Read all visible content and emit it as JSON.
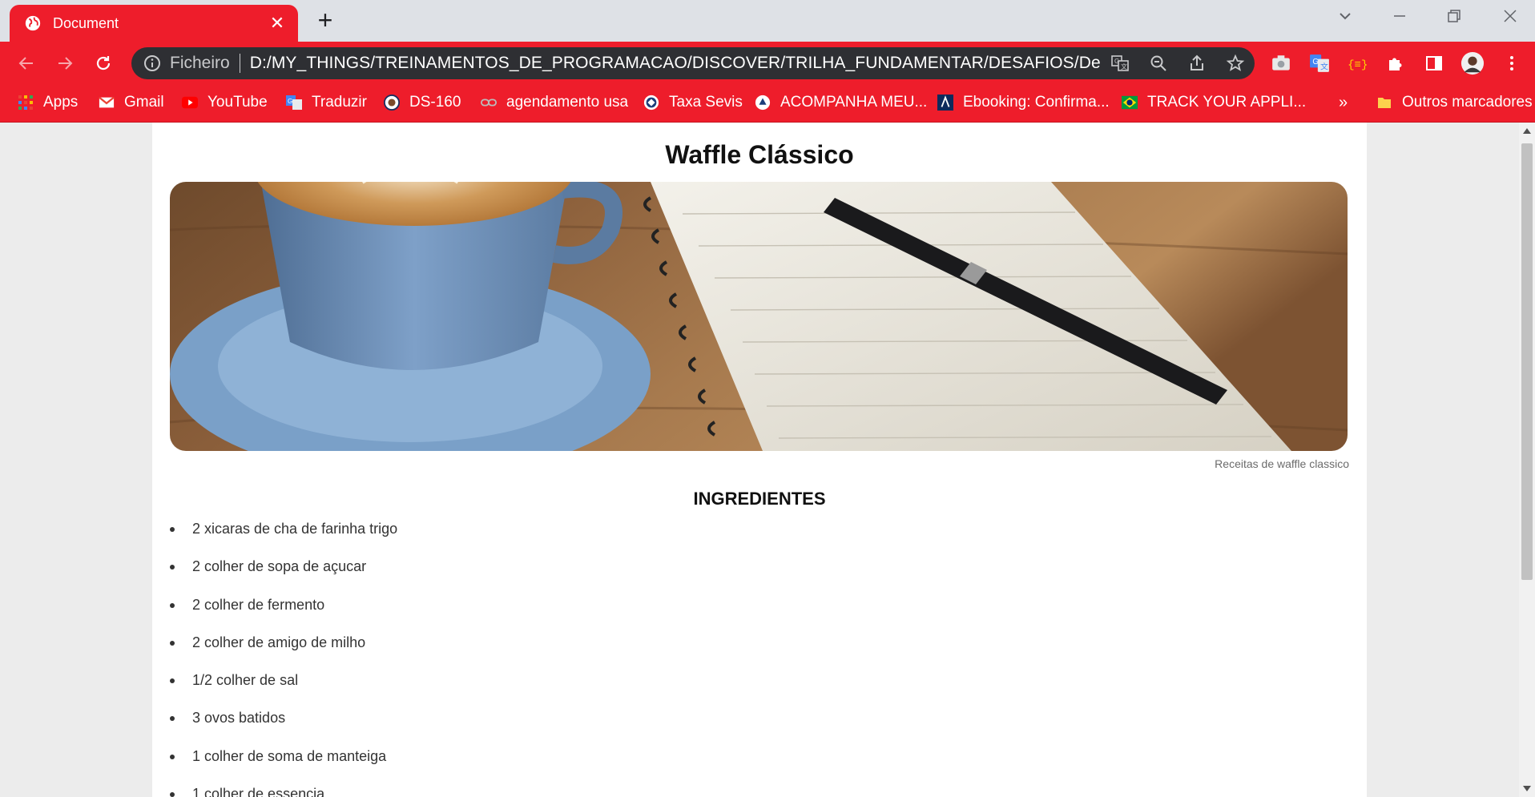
{
  "browser": {
    "tab_title": "Document",
    "tab_close_glyph": "✕",
    "new_tab_glyph": "+",
    "address_scheme": "Ficheiro",
    "address_url": "D:/MY_THINGS/TREINAMENTOS_DE_PROGRAMACAO/DISCOVER/TRILHA_FUNDAMENTAR/DESAFIOS/Desafio%...",
    "colors": {
      "chrome_accent": "#ee1d2b",
      "omnibox_bg": "#2e2f33",
      "tabstrip_bg": "#dee1e6"
    },
    "icons": [
      "back-icon",
      "forward-icon",
      "reload-icon",
      "info-icon",
      "translate-icon",
      "zoom-out-icon",
      "share-icon",
      "star-icon",
      "camera-icon",
      "google-translate-icon",
      "code-icon",
      "puzzle-icon",
      "side-panel-icon",
      "profile-avatar",
      "menu-icon"
    ]
  },
  "bookmarks": {
    "items": [
      {
        "label": "Apps",
        "icon": "apps-grid-icon"
      },
      {
        "label": "Gmail",
        "icon": "gmail-icon"
      },
      {
        "label": "YouTube",
        "icon": "youtube-icon"
      },
      {
        "label": "Traduzir",
        "icon": "translate-icon"
      },
      {
        "label": "DS-160",
        "icon": "seal-icon"
      },
      {
        "label": "agendamento usa",
        "icon": "link-icon"
      },
      {
        "label": "Taxa Sevis",
        "icon": "sevis-icon"
      },
      {
        "label": "ACOMPANHA MEU...",
        "icon": "uscis-icon"
      },
      {
        "label": "Ebooking: Confirma...",
        "icon": "ebooking-icon"
      },
      {
        "label": "TRACK YOUR APPLI...",
        "icon": "brazil-flag-icon"
      }
    ],
    "more_glyph": "»",
    "other_label": "Outros marcadores"
  },
  "page": {
    "title": "Waffle Clássico",
    "image_caption": "Receitas de waffle classico",
    "section_title": "INGREDIENTES",
    "ingredients": [
      "2 xicaras de cha de farinha trigo",
      "2 colher de sopa de açucar",
      "2 colher de fermento",
      "2 colher de amigo de milho",
      "1/2 colher de sal",
      "3 ovos batidos",
      "1 colher de soma de manteiga",
      "1 colher de essencia"
    ]
  }
}
